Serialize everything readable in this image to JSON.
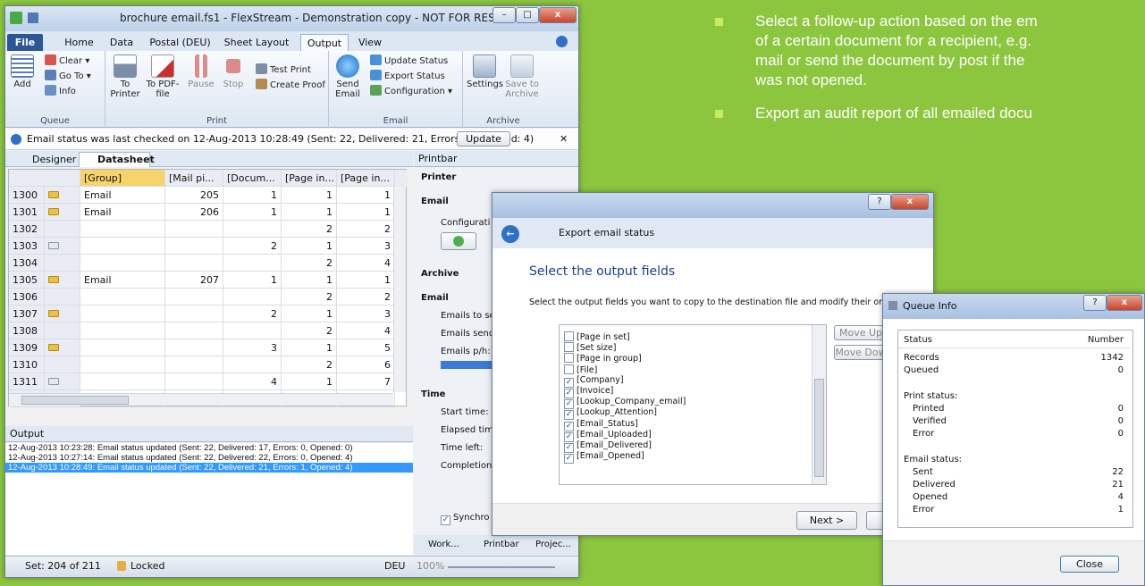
{
  "bullets": {
    "line1": "Select a follow-up action based on the em",
    "line2": "of a certain document for a recipient, e.g.",
    "line3": "mail or send the document by post if the",
    "line4": "was not opened.",
    "line5": "Export an audit report of all emailed docu"
  },
  "main_window": {
    "title": "brochure email.fs1 - FlexStream - Demonstration copy - NOT FOR RESALE",
    "tabs": [
      "File",
      "Home",
      "Data",
      "Postal (DEU)",
      "Sheet Layout",
      "Output",
      "View"
    ],
    "ribbon": {
      "queue": {
        "label": "Queue",
        "add": "Add",
        "clear": "Clear",
        "goto": "Go To",
        "info": "Info"
      },
      "print": {
        "label": "Print",
        "to_printer": "To Printer",
        "to_pdf": "To PDF-file",
        "pause": "Pause",
        "stop": "Stop",
        "test_print": "Test Print",
        "create_proof": "Create Proof"
      },
      "email": {
        "label": "Email",
        "send_email": "Send Email",
        "update_status": "Update Status",
        "export_status": "Export Status",
        "configuration": "Configuration"
      },
      "archive": {
        "label": "Archive",
        "settings": "Settings",
        "save_to_archive": "Save to Archive"
      }
    },
    "infobar": {
      "text": "Email status was last checked on 12-Aug-2013 10:28:49 (Sent: 22, Delivered: 21, Errors: 1, Opened: 4)",
      "button": "Update"
    },
    "doc_tabs": [
      "Designer",
      "Datasheet"
    ],
    "grid": {
      "headers": [
        "[Group]",
        "[Mail pi...",
        "[Docum...",
        "[Page in...",
        "[Page in..."
      ],
      "rows": [
        {
          "id": "1300",
          "icon": "mail-error",
          "group": "Email",
          "mail": "205",
          "doc": "1",
          "p1": "1",
          "p2": "1"
        },
        {
          "id": "1301",
          "icon": "mail",
          "group": "Email",
          "mail": "206",
          "doc": "1",
          "p1": "1",
          "p2": "1"
        },
        {
          "id": "1302",
          "icon": "",
          "group": "",
          "mail": "",
          "doc": "",
          "p1": "2",
          "p2": "2"
        },
        {
          "id": "1303",
          "icon": "mail-open",
          "group": "",
          "mail": "",
          "doc": "2",
          "p1": "1",
          "p2": "3"
        },
        {
          "id": "1304",
          "icon": "",
          "group": "",
          "mail": "",
          "doc": "",
          "p1": "2",
          "p2": "4"
        },
        {
          "id": "1305",
          "icon": "mail",
          "group": "Email",
          "mail": "207",
          "doc": "1",
          "p1": "1",
          "p2": "1"
        },
        {
          "id": "1306",
          "icon": "",
          "group": "",
          "mail": "",
          "doc": "",
          "p1": "2",
          "p2": "2"
        },
        {
          "id": "1307",
          "icon": "mail",
          "group": "",
          "mail": "",
          "doc": "2",
          "p1": "1",
          "p2": "3"
        },
        {
          "id": "1308",
          "icon": "",
          "group": "",
          "mail": "",
          "doc": "",
          "p1": "2",
          "p2": "4"
        },
        {
          "id": "1309",
          "icon": "mail",
          "group": "",
          "mail": "",
          "doc": "3",
          "p1": "1",
          "p2": "5"
        },
        {
          "id": "1310",
          "icon": "",
          "group": "",
          "mail": "",
          "doc": "",
          "p1": "2",
          "p2": "6"
        },
        {
          "id": "1311",
          "icon": "mail-open",
          "group": "",
          "mail": "",
          "doc": "4",
          "p1": "1",
          "p2": "7"
        },
        {
          "id": "1312",
          "icon": "",
          "group": "",
          "mail": "",
          "doc": "",
          "p1": "2",
          "p2": "8"
        }
      ]
    },
    "output": {
      "title": "Output",
      "lines": [
        "12-Aug-2013 10:23:28: Email status updated (Sent: 22, Delivered: 17, Errors: 0, Opened: 0)",
        "12-Aug-2013 10:27:14: Email status updated (Sent: 22, Delivered: 22, Errors: 0, Opened: 4)",
        "12-Aug-2013 10:28:49: Email status updated (Sent: 22, Delivered: 21, Errors: 1, Opened: 4)"
      ]
    },
    "printbar": {
      "title": "Printbar",
      "printer": "Printer",
      "email": "Email",
      "configuration": "Configurati",
      "archive": "Archive",
      "email2": "Email",
      "emails_to_send": "Emails to se",
      "emails_sent": "Emails send",
      "emails_ph": "Emails p/h:",
      "time": "Time",
      "start": "Start time:",
      "elapsed": "Elapsed time",
      "left": "Time left:",
      "completion": "Completion",
      "sync": "Synchro"
    },
    "bottom_tabs": [
      "Work...",
      "Printbar",
      "Projec..."
    ],
    "status": {
      "set": "Set: 204 of 211",
      "locked": "Locked",
      "lang": "DEU",
      "zoom": "100%"
    }
  },
  "export_dialog": {
    "header": "Export email status",
    "heading": "Select the output fields",
    "instruction": "Select the output fields you want to copy to the destination file and modify their order.",
    "fields": [
      {
        "name": "[Page in set]",
        "checked": false
      },
      {
        "name": "[Set size]",
        "checked": false
      },
      {
        "name": "[Page in group]",
        "checked": false
      },
      {
        "name": "[File]",
        "checked": false
      },
      {
        "name": "[Company]",
        "checked": true
      },
      {
        "name": "[Invoice]",
        "checked": true
      },
      {
        "name": "[Lookup_Company_email]",
        "checked": true
      },
      {
        "name": "[Lookup_Attention]",
        "checked": true
      },
      {
        "name": "[Email_Status]",
        "checked": true
      },
      {
        "name": "[Email_Uploaded]",
        "checked": true
      },
      {
        "name": "[Email_Delivered]",
        "checked": true
      },
      {
        "name": "[Email_Opened]",
        "checked": true
      }
    ],
    "move_up": "Move Up",
    "move_down": "Move Dow",
    "next": "Next >",
    "help": "?",
    "close": "x"
  },
  "queue_dialog": {
    "title": "Queue Info",
    "col_status": "Status",
    "col_number": "Number",
    "rows": [
      {
        "label": "Records",
        "value": "1342",
        "indent": false
      },
      {
        "label": "Queued",
        "value": "0",
        "indent": false
      },
      {
        "label": "",
        "value": "",
        "indent": false
      },
      {
        "label": "Print status:",
        "value": "",
        "indent": false
      },
      {
        "label": "Printed",
        "value": "0",
        "indent": true
      },
      {
        "label": "Verified",
        "value": "0",
        "indent": true
      },
      {
        "label": "Error",
        "value": "0",
        "indent": true
      },
      {
        "label": "",
        "value": "",
        "indent": false
      },
      {
        "label": "Email status:",
        "value": "",
        "indent": false
      },
      {
        "label": "Sent",
        "value": "22",
        "indent": true
      },
      {
        "label": "Delivered",
        "value": "21",
        "indent": true
      },
      {
        "label": "Opened",
        "value": "4",
        "indent": true
      },
      {
        "label": "Error",
        "value": "1",
        "indent": true
      }
    ],
    "close": "Close",
    "help": "?"
  },
  "colors": {
    "background": "#8cc63f",
    "accent": "#2b5797",
    "selection": "#3399ff"
  }
}
